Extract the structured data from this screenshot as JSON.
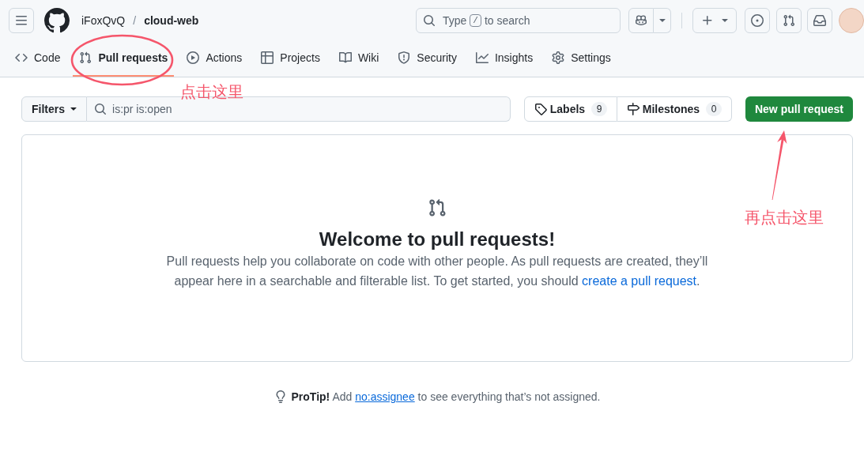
{
  "header": {
    "owner": "iFoxQvQ",
    "separator": "/",
    "repo": "cloud-web",
    "search": {
      "placeholder": "Type",
      "shortcut_key": "/",
      "placeholder_end": "to search"
    }
  },
  "tabs": [
    {
      "label": "Code",
      "selected": false
    },
    {
      "label": "Pull requests",
      "selected": true
    },
    {
      "label": "Actions",
      "selected": false
    },
    {
      "label": "Projects",
      "selected": false
    },
    {
      "label": "Wiki",
      "selected": false
    },
    {
      "label": "Security",
      "selected": false
    },
    {
      "label": "Insights",
      "selected": false
    },
    {
      "label": "Settings",
      "selected": false
    }
  ],
  "toolbar": {
    "filters_button": "Filters",
    "filter_query": {
      "value": "is:pr is:open"
    },
    "labels": {
      "label": "Labels",
      "count": "9"
    },
    "milestones": {
      "label": "Milestones",
      "count": "0"
    },
    "new_button": "New pull request"
  },
  "blankslate": {
    "title": "Welcome to pull requests!",
    "text": "Pull requests help you collaborate on code with other people. As pull requests are created, they’ll appear here in a searchable and filterable list. To get started, you should",
    "link": "create a pull request",
    "text_end": "."
  },
  "protip": {
    "text": "**ProTip!** Add",
    "link": "no:assignee",
    "text_end": "to see everything that’s not assigned."
  },
  "annotations": [
    {
      "kind": "ellipse",
      "text": "点击这里"
    },
    {
      "kind": "arrow",
      "text": "再点击这里"
    }
  ]
}
